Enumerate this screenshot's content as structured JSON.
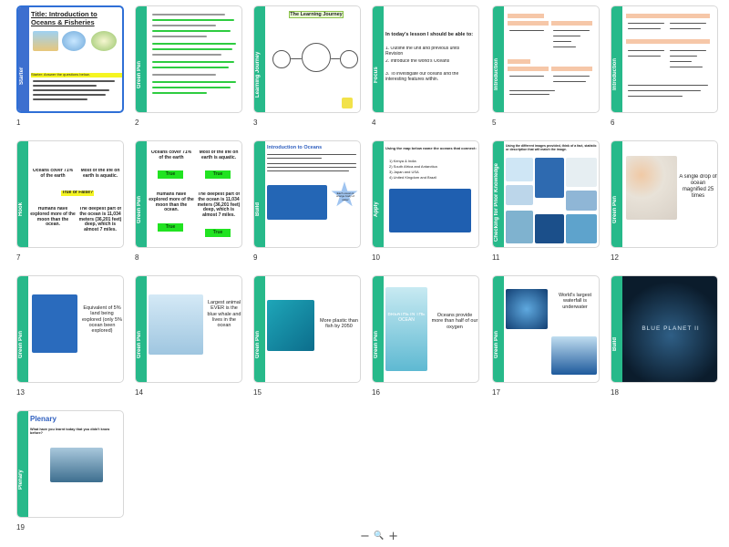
{
  "slides": [
    {
      "num": "1",
      "title": "Title: Introduction to Oceans & Fisheries",
      "label": "Starter",
      "starter": "Starter: Answer the questions below."
    },
    {
      "num": "2",
      "label": "Green Pen"
    },
    {
      "num": "3",
      "label": "Learning Journey",
      "title": "The Learning Journey"
    },
    {
      "num": "4",
      "label": "Focus",
      "intro": "In today's lesson I should be able to:",
      "obj1": "1.  Outline the unit and previous units Revision",
      "obj2": "2.  Introduce the world's Oceans",
      "obj3": "3.  To investigate our oceans and the interesting features within."
    },
    {
      "num": "5",
      "label": "Introduction"
    },
    {
      "num": "6",
      "label": "Introduction"
    },
    {
      "num": "7",
      "label": "Hook",
      "q1": "Oceans cover 71% of the earth",
      "q2": "Most of the life on earth is aquatic.",
      "tf": "True or False?",
      "q3": "Humans have explored more of the moon than the ocean.",
      "q4": "The deepest part of the ocean is 11,034 meters (36,201 feet) deep, which is almost 7 miles."
    },
    {
      "num": "8",
      "label": "Green Pen",
      "q1": "Oceans cover 71% of the earth",
      "q2": "Most of the life on earth is aquatic.",
      "q3": "Humans have explored more of the moon than the ocean.",
      "q4": "The deepest part of the ocean is 11,034 meters (36,201 feet) deep, which is almost 7 miles.",
      "answer": "True"
    },
    {
      "num": "9",
      "label": "Build",
      "title": "Introduction to Oceans",
      "badge": "Each ocean is a large body of water"
    },
    {
      "num": "10",
      "label": "Apply",
      "task": "Using the map below name the oceans that connect:",
      "i1": "1) Kenya & India",
      "i2": "2) South Africa and Antarctica",
      "i3": "3) Japan and USA",
      "i4": "4) United Kingdom and Brazil"
    },
    {
      "num": "11",
      "label": "Checking for Prior Knowledge",
      "task": "Using the different images provided, think of a fact, statistic or description that will match the image."
    },
    {
      "num": "12",
      "label": "Green Pen",
      "text": "A single drop of ocean magnified 25 times"
    },
    {
      "num": "13",
      "label": "Green Pen",
      "text": "Equivalent of 5% land being explored (only 5% ocean been explored)"
    },
    {
      "num": "14",
      "label": "Green Pen",
      "text": "Largest animal EVER is the blue whale and lives in the ocean"
    },
    {
      "num": "15",
      "label": "Green Pen",
      "text": "More plastic than fish by 2050"
    },
    {
      "num": "16",
      "label": "Green Pen",
      "text": "Oceans provide more than half of our oxygen",
      "img_text": "BREATHE IN THE OCEAN"
    },
    {
      "num": "17",
      "label": "Green Pen",
      "text": "World's largest waterfall is underwater"
    },
    {
      "num": "18",
      "label": "Build",
      "title": "BLUE PLANET II"
    },
    {
      "num": "19",
      "label": "Plenary",
      "title": "Plenary",
      "question": "What have you learnt today that you didn't know before?"
    }
  ],
  "answers": {
    "a1": "True",
    "a2": "True",
    "a3": "True",
    "a4": "True"
  },
  "zoom": {
    "out": "−",
    "search": "🔍",
    "in": "+"
  },
  "colors": {
    "accent_green": "#27b98a",
    "accent_blue": "#3d6fcf",
    "selection": "#2f6fd6",
    "answer_green": "#21e321"
  }
}
